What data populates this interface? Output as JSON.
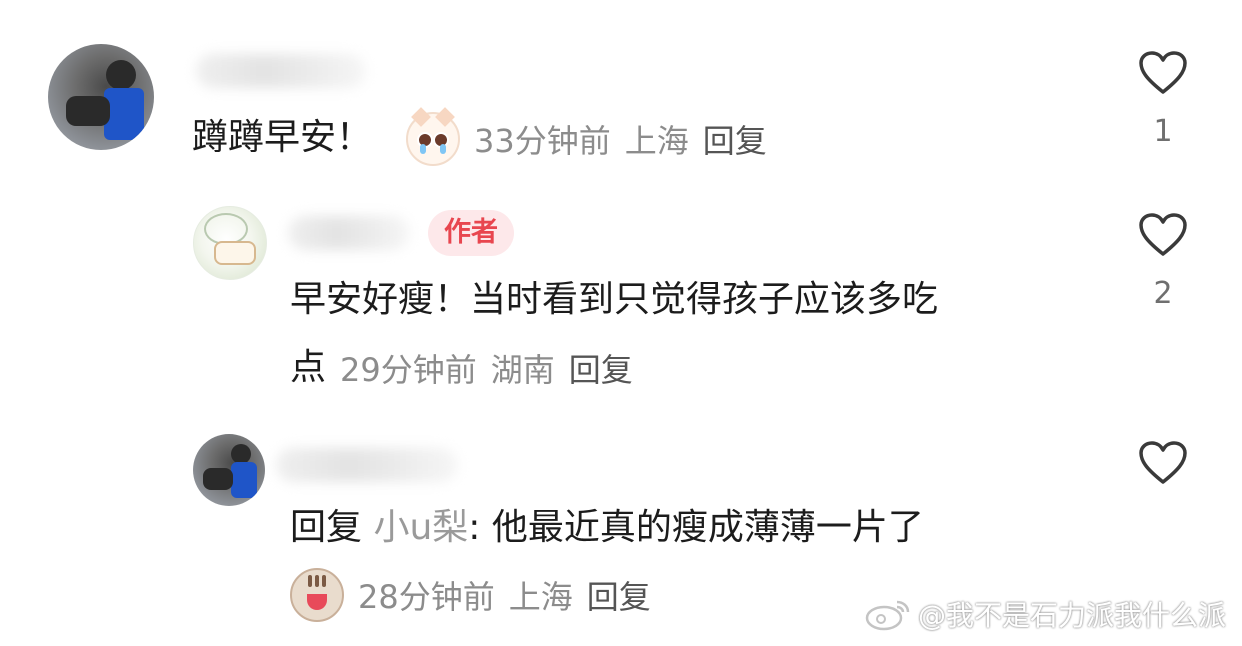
{
  "comments": [
    {
      "text": "蹲蹲早安！",
      "time": "33分钟前",
      "location": "上海",
      "reply_label": "回复",
      "like_count": "1",
      "emoji": "crying-cat-emoji"
    },
    {
      "badge": "作者",
      "text_line1": "早安好瘦！当时看到只觉得孩子应该多吃",
      "text_line2": "点",
      "time": "29分钟前",
      "location": "湖南",
      "reply_label": "回复",
      "like_count": "2"
    },
    {
      "reply_prefix": "回复",
      "mention": "小u梨",
      "text": ": 他最近真的瘦成薄薄一片了",
      "time": "28分钟前",
      "location": "上海",
      "reply_label": "回复",
      "like_count": "",
      "emoji": "shocked-tabby-cat-emoji"
    }
  ],
  "watermark": {
    "text": "@我不是石力派我什么派",
    "icon": "weibo-logo-icon"
  },
  "colors": {
    "badge_text": "#e8464f",
    "badge_bg": "#fde8ea",
    "meta": "#8c8c8c"
  }
}
